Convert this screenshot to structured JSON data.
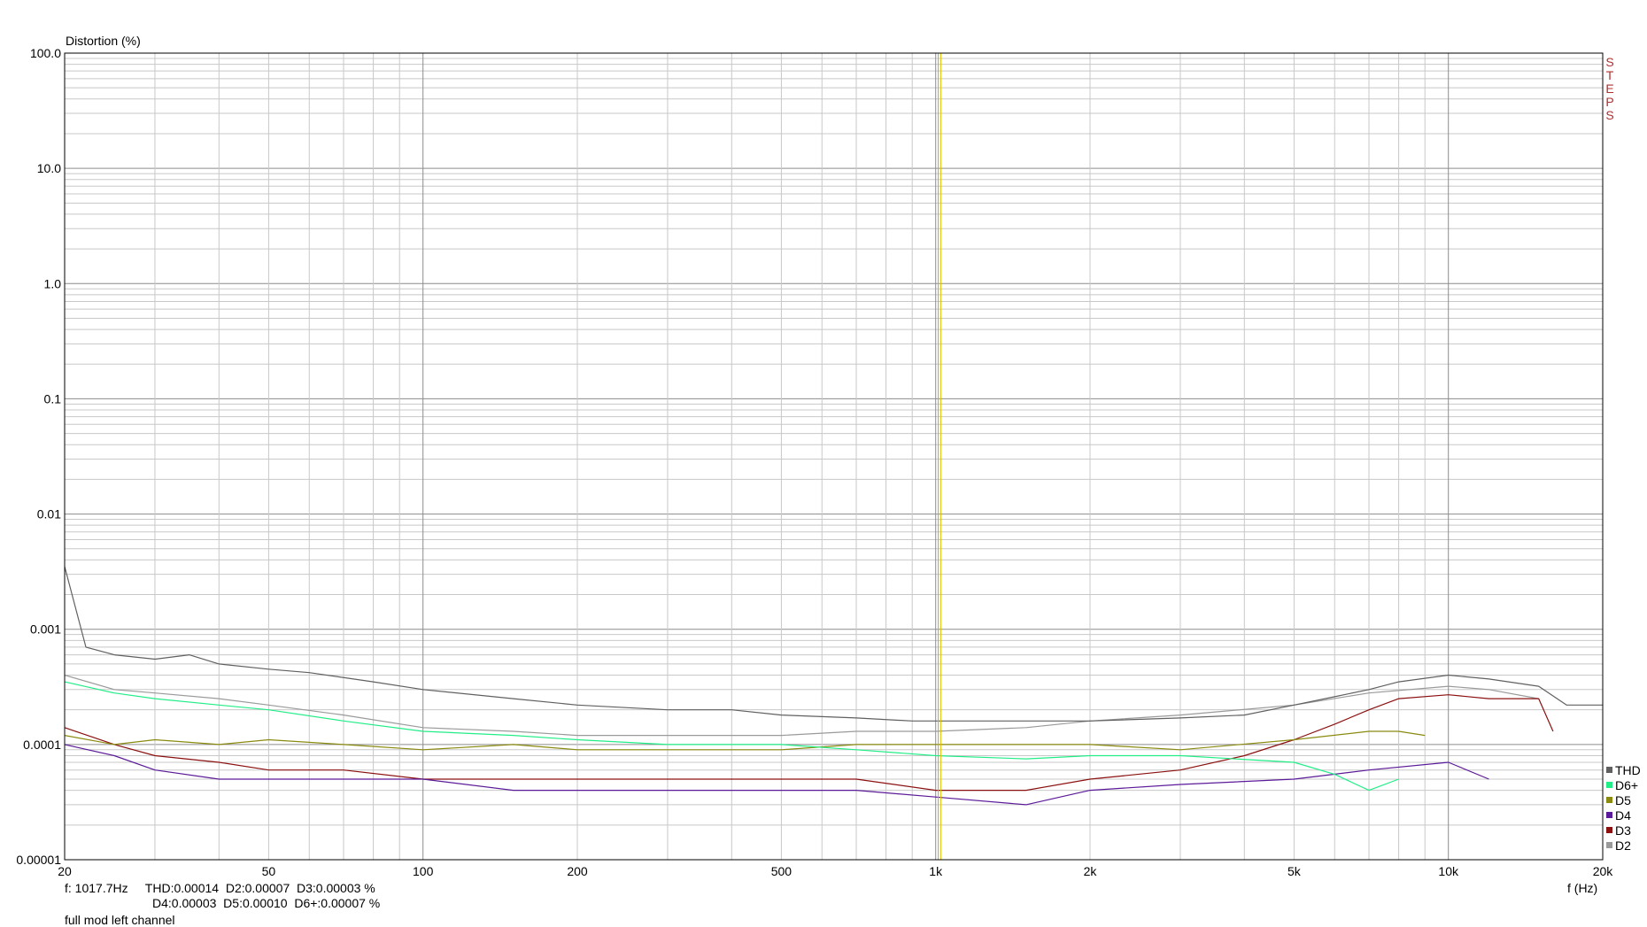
{
  "chart_data": {
    "type": "line",
    "ylabel": "Distortion (%)",
    "xlabel": "f (Hz)",
    "x_scale": "log",
    "y_scale": "log",
    "xlim": [
      20,
      20000
    ],
    "ylim": [
      1e-05,
      100
    ],
    "y_ticks": [
      {
        "value": 100,
        "label": "100.0"
      },
      {
        "value": 10,
        "label": "10.0"
      },
      {
        "value": 1,
        "label": "1.0"
      },
      {
        "value": 0.1,
        "label": "0.1"
      },
      {
        "value": 0.01,
        "label": "0.01"
      },
      {
        "value": 0.001,
        "label": "0.001"
      },
      {
        "value": 0.0001,
        "label": "0.0001"
      },
      {
        "value": 1e-05,
        "label": "0.00001"
      }
    ],
    "x_ticks": [
      {
        "value": 20,
        "label": "20"
      },
      {
        "value": 50,
        "label": "50"
      },
      {
        "value": 100,
        "label": "100"
      },
      {
        "value": 200,
        "label": "200"
      },
      {
        "value": 500,
        "label": "500"
      },
      {
        "value": 1000,
        "label": "1k"
      },
      {
        "value": 2000,
        "label": "2k"
      },
      {
        "value": 5000,
        "label": "5k"
      },
      {
        "value": 10000,
        "label": "10k"
      },
      {
        "value": 20000,
        "label": "20k"
      }
    ],
    "grid": true,
    "legend_position": "bottom-right",
    "cursor_frequency": 1017.7,
    "brand_label": "STEPS",
    "readout_line1": "f: 1017.7Hz     THD:0.00014  D2:0.00007  D3:0.00003 %",
    "readout_line2": "D4:0.00003  D5:0.00010  D6+:0.00007 %",
    "caption": "full mod left channel",
    "series": [
      {
        "name": "THD",
        "color": "#606060",
        "x": [
          20,
          22,
          25,
          30,
          35,
          40,
          50,
          60,
          80,
          100,
          150,
          200,
          300,
          400,
          500,
          700,
          900,
          1000,
          1500,
          2000,
          3000,
          4000,
          5000,
          6000,
          7000,
          8000,
          10000,
          12000,
          15000,
          17000,
          20000
        ],
        "y": [
          0.0035,
          0.0007,
          0.0006,
          0.00055,
          0.0006,
          0.0005,
          0.00045,
          0.00042,
          0.00035,
          0.0003,
          0.00025,
          0.00022,
          0.0002,
          0.0002,
          0.00018,
          0.00017,
          0.00016,
          0.00016,
          0.00016,
          0.00016,
          0.00017,
          0.00018,
          0.00022,
          0.00026,
          0.0003,
          0.00035,
          0.0004,
          0.00037,
          0.00032,
          0.00022,
          0.00022
        ]
      },
      {
        "name": "D6+",
        "color": "#22ee88",
        "x": [
          20,
          25,
          30,
          40,
          50,
          70,
          100,
          150,
          200,
          300,
          500,
          700,
          1000,
          1500,
          2000,
          3000,
          5000,
          6000,
          7000,
          8000
        ],
        "y": [
          0.00035,
          0.00028,
          0.00025,
          0.00022,
          0.0002,
          0.00016,
          0.00013,
          0.00012,
          0.00011,
          0.0001,
          0.0001,
          9e-05,
          8e-05,
          7.5e-05,
          8e-05,
          8e-05,
          7e-05,
          5.5e-05,
          4e-05,
          5e-05
        ]
      },
      {
        "name": "D5",
        "color": "#8a8a10",
        "x": [
          20,
          25,
          30,
          40,
          50,
          70,
          100,
          150,
          200,
          300,
          500,
          700,
          1000,
          1500,
          2000,
          3000,
          5000,
          7000,
          8000,
          9000
        ],
        "y": [
          0.00012,
          0.0001,
          0.00011,
          0.0001,
          0.00011,
          0.0001,
          9e-05,
          0.0001,
          9e-05,
          9e-05,
          9e-05,
          0.0001,
          0.0001,
          0.0001,
          0.0001,
          9e-05,
          0.00011,
          0.00013,
          0.00013,
          0.00012
        ]
      },
      {
        "name": "D4",
        "color": "#5b1a99",
        "x": [
          20,
          25,
          30,
          40,
          50,
          70,
          100,
          150,
          200,
          300,
          500,
          700,
          1000,
          1500,
          2000,
          3000,
          5000,
          7000,
          10000,
          12000
        ],
        "y": [
          0.0001,
          8e-05,
          6e-05,
          5e-05,
          5e-05,
          5e-05,
          5e-05,
          4e-05,
          4e-05,
          4e-05,
          4e-05,
          4e-05,
          3.5e-05,
          3e-05,
          4e-05,
          4.5e-05,
          5e-05,
          6e-05,
          7e-05,
          5e-05
        ]
      },
      {
        "name": "D3",
        "color": "#8b1010",
        "x": [
          20,
          25,
          30,
          40,
          50,
          70,
          100,
          150,
          200,
          300,
          500,
          700,
          1000,
          1500,
          2000,
          3000,
          4000,
          5000,
          6000,
          7000,
          8000,
          10000,
          12000,
          15000,
          16000
        ],
        "y": [
          0.00014,
          0.0001,
          8e-05,
          7e-05,
          6e-05,
          6e-05,
          5e-05,
          5e-05,
          5e-05,
          5e-05,
          5e-05,
          5e-05,
          4e-05,
          4e-05,
          5e-05,
          6e-05,
          8e-05,
          0.00011,
          0.00015,
          0.0002,
          0.00025,
          0.00027,
          0.00025,
          0.00025,
          0.00013
        ]
      },
      {
        "name": "D2",
        "color": "#9a9a9a",
        "x": [
          20,
          25,
          30,
          40,
          50,
          70,
          100,
          150,
          200,
          300,
          500,
          700,
          1000,
          1500,
          2000,
          3000,
          5000,
          7000,
          10000,
          12000,
          15000
        ],
        "y": [
          0.0004,
          0.0003,
          0.00028,
          0.00025,
          0.00022,
          0.00018,
          0.00014,
          0.00013,
          0.00012,
          0.00012,
          0.00012,
          0.00013,
          0.00013,
          0.00014,
          0.00016,
          0.00018,
          0.00022,
          0.00028,
          0.00032,
          0.0003,
          0.00025
        ]
      }
    ]
  }
}
